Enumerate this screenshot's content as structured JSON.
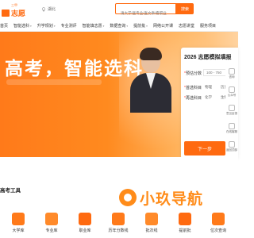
{
  "header": {
    "logo_small": "三甲",
    "logo_text": "志愿",
    "location": "湖北",
    "search_placeholder": "请大学/查专业/查文章/看职业",
    "search_button": "搜索"
  },
  "nav": [
    {
      "label": "首页",
      "caret": false,
      "active": false
    },
    {
      "label": "智能选科",
      "caret": true,
      "active": false
    },
    {
      "label": "升学规划",
      "caret": true,
      "active": false
    },
    {
      "label": "专业测评",
      "caret": false,
      "active": false
    },
    {
      "label": "智能填志愿",
      "caret": true,
      "active": false
    },
    {
      "label": "数据查询",
      "caret": true,
      "active": false
    },
    {
      "label": "提前批",
      "caret": true,
      "active": false
    },
    {
      "label": "网络公开课",
      "caret": false,
      "active": false
    },
    {
      "label": "志愿讲堂",
      "caret": false,
      "active": false
    },
    {
      "label": "服务项目",
      "caret": false,
      "active": false
    }
  ],
  "banner": {
    "headline": "高考，智能选科"
  },
  "form": {
    "title": "2026 志愿模拟填报",
    "score_label": "*预估分数",
    "score_placeholder": "100 - 750",
    "first_subject_label": "*首选科目",
    "first_subject_options": [
      "物理",
      "历史"
    ],
    "second_subject_label": "*再选科目",
    "second_subject_options": [
      "化学",
      "生物"
    ],
    "next_button": "下一步"
  },
  "float_bar": [
    {
      "label": "咨询",
      "icon": "chat-icon"
    },
    {
      "label": "公众号",
      "icon": "qr-icon"
    },
    {
      "label": "意见反馈",
      "icon": "feedback-icon"
    },
    {
      "label": "在线客服",
      "icon": "service-icon"
    },
    {
      "label": "返回顶部",
      "icon": "top-icon"
    }
  ],
  "tools": {
    "title": "高考工具",
    "items": [
      {
        "label": "大学库",
        "color": "#ff7a1a"
      },
      {
        "label": "专业库",
        "color": "#ff8a2a"
      },
      {
        "label": "职业库",
        "color": "#ff6a10"
      },
      {
        "label": "历年分数线",
        "color": "#ff7a1a"
      },
      {
        "label": "批次线",
        "color": "#ff8a2a"
      },
      {
        "label": "提前批",
        "color": "#ff6a10"
      },
      {
        "label": "位次查询",
        "color": "#ff7a1a"
      }
    ]
  },
  "watermark": {
    "text": "小玖导航"
  },
  "colors": {
    "accent": "#ff6a10",
    "banner": "#ff8a1f"
  }
}
